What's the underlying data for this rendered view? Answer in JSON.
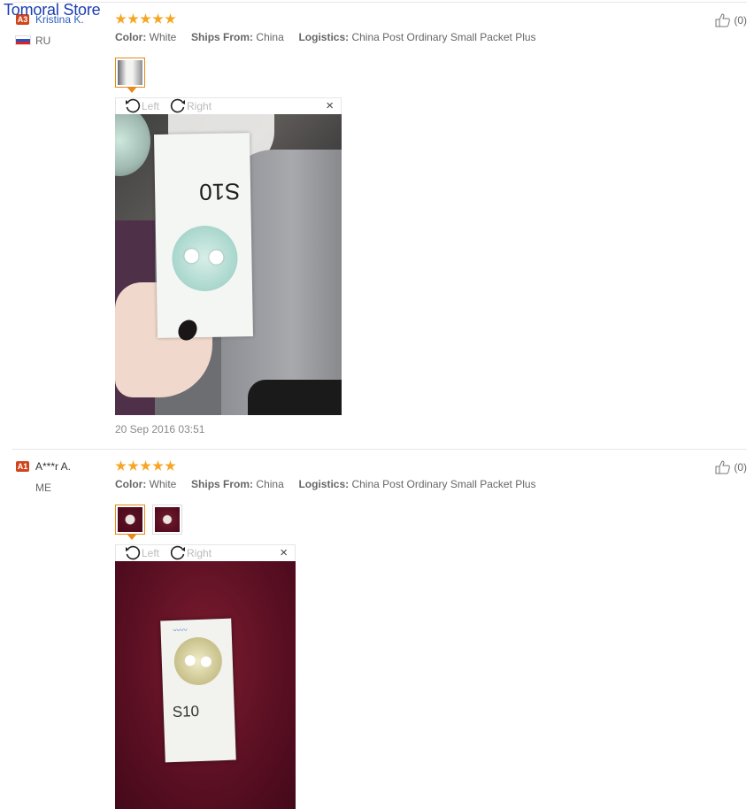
{
  "watermark": "Tomoral Store",
  "reviews": [
    {
      "badge": "A3",
      "name": "Kristina K.",
      "country": "RU",
      "color_label": "Color:",
      "color_value": "White",
      "ships_label": "Ships From:",
      "ships_value": "China",
      "logistics_label": "Logistics:",
      "logistics_value": "China Post Ordinary Small Packet Plus",
      "likes": "(0)",
      "rotate_left": "Left",
      "rotate_right": "Right",
      "close": "×",
      "date": "20 Sep 2016 03:51"
    },
    {
      "badge": "A1",
      "name": "A***r A.",
      "country": "ME",
      "color_label": "Color:",
      "color_value": "White",
      "ships_label": "Ships From:",
      "ships_value": "China",
      "logistics_label": "Logistics:",
      "logistics_value": "China Post Ordinary Small Packet Plus",
      "likes": "(0)",
      "rotate_left": "Left",
      "rotate_right": "Right",
      "close": "×"
    }
  ],
  "product_label": "S10",
  "icons": [
    "star-icon",
    "thumbs-up-icon",
    "rotate-left-icon",
    "rotate-right-icon",
    "close-icon",
    "flag-ru-icon"
  ],
  "colors": {
    "star": "#f5a623",
    "badge": "#d0451b",
    "active_thumb": "#e8891a"
  }
}
